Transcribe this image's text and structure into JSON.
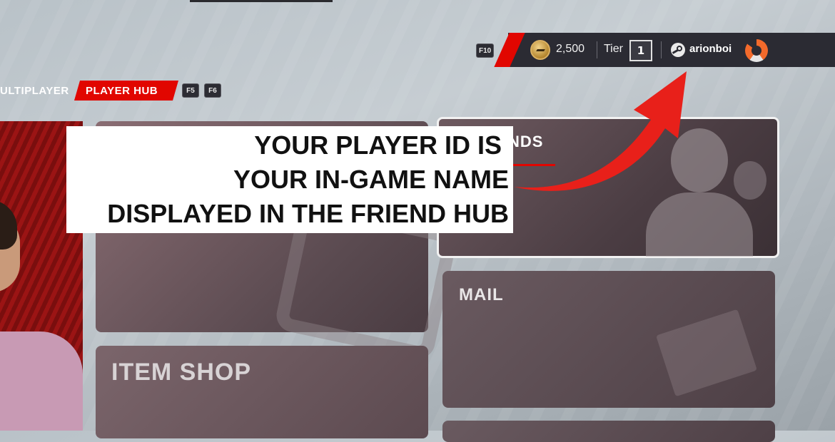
{
  "status_bar": {
    "key_f10": "F10",
    "coins": "2,500",
    "tier_label": "Tier",
    "tier_value": "1",
    "platform_icon": "steam-icon",
    "username": "arionboi",
    "profile_icon": "profile-emblem-icon"
  },
  "breadcrumb": {
    "previous": "ULTIPLAYER",
    "active": "PLAYER HUB",
    "key_f5": "F5",
    "key_f6": "F6"
  },
  "tiles": {
    "friends": "NDS",
    "mail": "MAIL",
    "item_shop": "ITEM SHOP"
  },
  "annotation": {
    "line1": "YOUR PLAYER ID IS",
    "line2": "YOUR IN-GAME NAME",
    "line3": "DISPLAYED IN THE FRIEND HUB",
    "arrow_color": "#e8201a"
  },
  "colors": {
    "accent_red": "#e10600",
    "status_bar": "#2b2b33"
  }
}
